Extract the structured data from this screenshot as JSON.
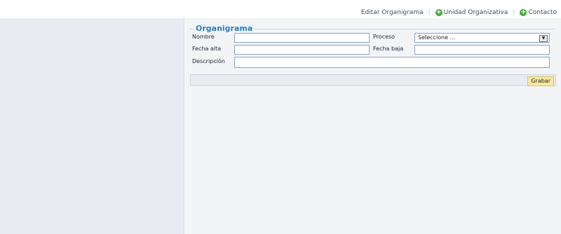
{
  "toolbar": {
    "edit_org": "Editar Organigrama",
    "org_unit": "Unidad Organizativa",
    "contact": "Contacto"
  },
  "form": {
    "legend": "Organigrama",
    "name_label": "Nombre",
    "name_value": "",
    "process_label": "Proceso",
    "process_selected": "Seleccione ...",
    "start_label": "Fecha alta",
    "start_value": "",
    "end_label": "Fecha baja",
    "end_value": "",
    "desc_label": "Descripción",
    "desc_value": ""
  },
  "actions": {
    "save_label": "Grabar"
  }
}
